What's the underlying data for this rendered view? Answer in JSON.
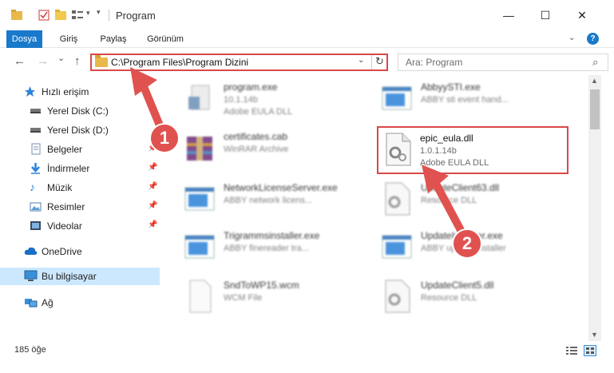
{
  "window": {
    "title": "Program",
    "minimize": "—",
    "maximize": "☐",
    "close": "✕"
  },
  "ribbon": {
    "tabs": [
      "Dosya",
      "Giriş",
      "Paylaş",
      "Görünüm"
    ],
    "expand": "⌄",
    "help": "?"
  },
  "navbar": {
    "back": "←",
    "forward": "→",
    "recent": "⌄",
    "up": "↑",
    "path": "C:\\Program Files\\Program Dizini",
    "search_placeholder": "Ara: Program"
  },
  "sidebar": {
    "items": [
      {
        "label": "Hızlı erişim",
        "icon": "star-icon",
        "pinned": false
      },
      {
        "label": "Yerel Disk (C:)",
        "icon": "drive-icon",
        "pinned": false
      },
      {
        "label": "Yerel Disk (D:)",
        "icon": "drive-icon",
        "pinned": false
      },
      {
        "label": "Belgeler",
        "icon": "documents-icon",
        "pinned": true
      },
      {
        "label": "İndirmeler",
        "icon": "download-icon",
        "pinned": true
      },
      {
        "label": "Müzik",
        "icon": "music-icon",
        "pinned": true
      },
      {
        "label": "Resimler",
        "icon": "pictures-icon",
        "pinned": true
      },
      {
        "label": "Videolar",
        "icon": "videos-icon",
        "pinned": true
      },
      {
        "label": "OneDrive",
        "icon": "cloud-icon",
        "pinned": false
      },
      {
        "label": "Bu bilgisayar",
        "icon": "computer-icon",
        "pinned": false
      },
      {
        "label": "Ağ",
        "icon": "network-icon",
        "pinned": false
      }
    ]
  },
  "files": [
    {
      "name": "program.exe",
      "line2": "10.1.14b",
      "line3": "Adobe EULA DLL",
      "icon": "exe-icon"
    },
    {
      "name": "AbbyySTI.exe",
      "line2": "ABBY sti event hand...",
      "line3": "",
      "icon": "app-icon"
    },
    {
      "name": "certificates.cab",
      "line2": "WinRAR Archive",
      "line3": "",
      "icon": "archive-icon"
    },
    {
      "name": "epic_eula.dll",
      "line2": "1.0.1.14b",
      "line3": "Adobe EULA DLL",
      "icon": "dll-icon"
    },
    {
      "name": "NetworkLicenseServer.exe",
      "line2": "ABBY network licens...",
      "line3": "",
      "icon": "app-icon"
    },
    {
      "name": "UpdateClient63.dll",
      "line2": "Resource DLL",
      "line3": "",
      "icon": "dll-icon"
    },
    {
      "name": "Trigrammsinstaller.exe",
      "line2": "ABBY finereader tra...",
      "line3": "",
      "icon": "app-icon"
    },
    {
      "name": "UpdateInstaller.exe",
      "line2": "ABBY update installer",
      "line3": "",
      "icon": "app-icon"
    },
    {
      "name": "SndToWP15.wcm",
      "line2": "WCM File",
      "line3": "",
      "icon": "file-icon"
    },
    {
      "name": "UpdateClient5.dll",
      "line2": "Resource DLL",
      "line3": "",
      "icon": "dll-icon"
    }
  ],
  "status": {
    "count": "185 öğe"
  },
  "annotations": {
    "step1": "1",
    "step2": "2",
    "color": "#e0524f"
  }
}
